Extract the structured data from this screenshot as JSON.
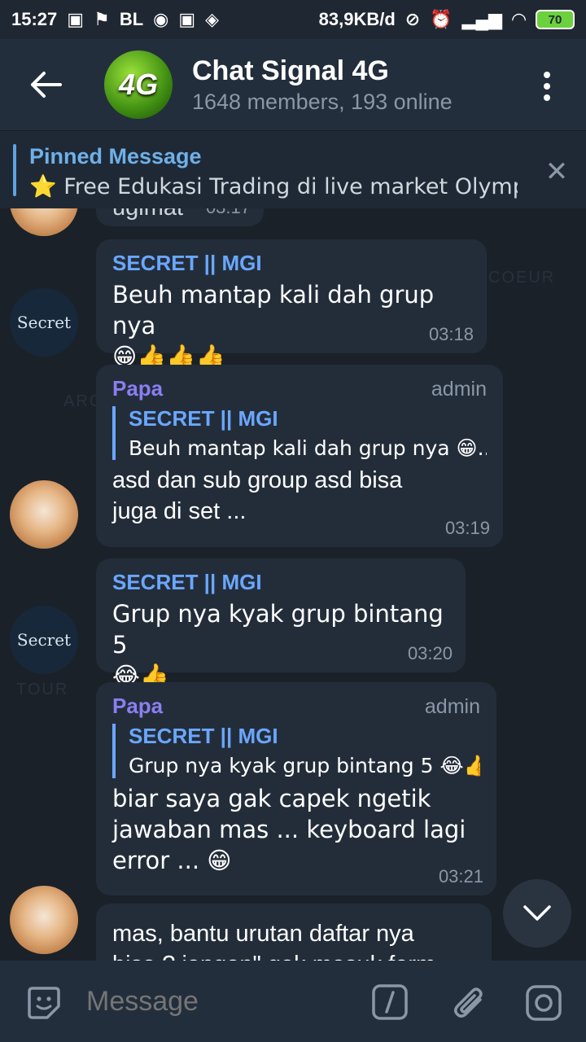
{
  "status_bar": {
    "time": "15:27",
    "left_indicators": "BL",
    "net_speed": "83,9KB/d",
    "battery": "70"
  },
  "header": {
    "avatar_text": "4G",
    "title": "Chat Signal 4G",
    "subtitle": "1648 members, 193 online"
  },
  "pinned": {
    "title": "Pinned Message",
    "text": "⭐ Free Edukasi Trading di live market Olymptr..."
  },
  "messages": [
    {
      "partial_text": "ugimat",
      "time": "03:17"
    },
    {
      "sender": "SECRET || MGI",
      "text_line1": "Beuh mantap kali dah grup nya",
      "text_line2": "😁👍👍👍",
      "time": "03:18",
      "avatar_text": "Secret"
    },
    {
      "sender": "Papa",
      "role": "admin",
      "reply_name": "SECRET || MGI",
      "reply_text": "Beuh mantap kali dah grup nya 😁...",
      "text_line1": "asd dan sub group asd bisa",
      "text_line2": "juga di set ...",
      "time": "03:19"
    },
    {
      "sender": "SECRET || MGI",
      "text_line1": "Grup nya kyak grup bintang 5",
      "text_line2": "😂👍",
      "time": "03:20",
      "avatar_text": "Secret"
    },
    {
      "sender": "Papa",
      "role": "admin",
      "reply_name": "SECRET || MGI",
      "reply_text": "Grup nya kyak grup bintang 5 😂👍",
      "text_line1": "biar saya gak capek ngetik",
      "text_line2": "jawaban mas ... keyboard lagi",
      "text_line3": "error ... 😁",
      "time": "03:21"
    },
    {
      "text_line1": "mas, bantu urutan daftar nya",
      "text_line2": "bisa ? jangan\" gak masuk form"
    }
  ],
  "input": {
    "placeholder": "Message"
  },
  "colors": {
    "header_bg": "#232e3c",
    "bubble_bg": "#232d3a",
    "sender_purple": "#8b7ef0",
    "sender_blue": "#6aa7ff"
  }
}
